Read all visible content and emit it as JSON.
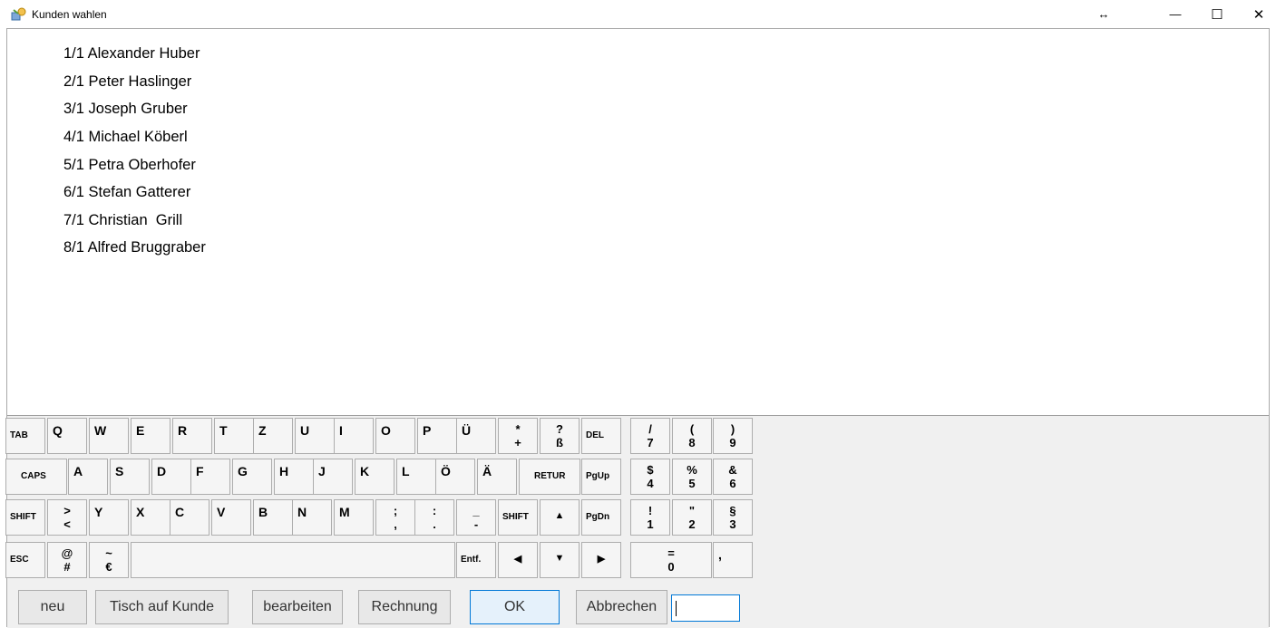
{
  "window": {
    "title": "Kunden wahlen",
    "resize_glyph": "↔",
    "minimize_glyph": "—",
    "maximize_glyph": "☐",
    "close_glyph": "✕"
  },
  "customers": [
    "1/1 Alexander Huber",
    "2/1 Peter Haslinger",
    "3/1 Joseph Gruber",
    "4/1 Michael Köberl",
    "5/1 Petra Oberhofer",
    "6/1 Stefan Gatterer",
    "7/1 Christian  Grill",
    "8/1 Alfred Bruggraber"
  ],
  "keys": {
    "tab": "TAB",
    "caps": "CAPS",
    "shift": "SHIFT",
    "esc": "ESC",
    "del": "DEL",
    "retur": "RETUR",
    "pgup": "PgUp",
    "pgdn": "PgDn",
    "entf": "Entf.",
    "q": "Q",
    "w": "W",
    "e": "E",
    "r": "R",
    "t": "T",
    "z": "Z",
    "u": "U",
    "i": "I",
    "o": "O",
    "p": "P",
    "ue": "Ü",
    "a": "A",
    "s": "S",
    "d": "D",
    "f": "F",
    "g": "G",
    "h": "H",
    "j": "J",
    "k": "K",
    "l": "L",
    "oe": "Ö",
    "ae": "Ä",
    "y": "Y",
    "x": "X",
    "c": "C",
    "v": "V",
    "b": "B",
    "n": "N",
    "m": "M",
    "star_top": "*",
    "star_bot": "+",
    "q_top": "?",
    "q_bot": "ß",
    "slash_top": "/",
    "slash_bot": "7",
    "lparen_top": "(",
    "lparen_bot": "8",
    "rparen_top": ")",
    "rparen_bot": "9",
    "dollar_top": "$",
    "dollar_bot": "4",
    "pct_top": "%",
    "pct_bot": "5",
    "amp_top": "&",
    "amp_bot": "6",
    "gt_top": ">",
    "gt_bot": "<",
    "semi_top": ";",
    "semi_bot": ",",
    "colon_top": ":",
    "colon_bot": ".",
    "under_top": "_",
    "under_bot": "-",
    "excl_top": "!",
    "excl_bot": "1",
    "quot_top": "\"",
    "quot_bot": "2",
    "sect_top": "§",
    "sect_bot": "3",
    "at_top": "@",
    "at_bot": "#",
    "tilde_top": "~",
    "tilde_bot": "€",
    "eq_top": "=",
    "eq_bot": "0",
    "comma": ",",
    "up": "▲",
    "down": "▼",
    "left": "◀",
    "right": "▶"
  },
  "buttons": {
    "neu": "neu",
    "tisch": "Tisch auf Kunde",
    "bearbeiten": "bearbeiten",
    "rechnung": "Rechnung",
    "ok": "OK",
    "abbrechen": "Abbrechen"
  },
  "input": {
    "value": ""
  }
}
